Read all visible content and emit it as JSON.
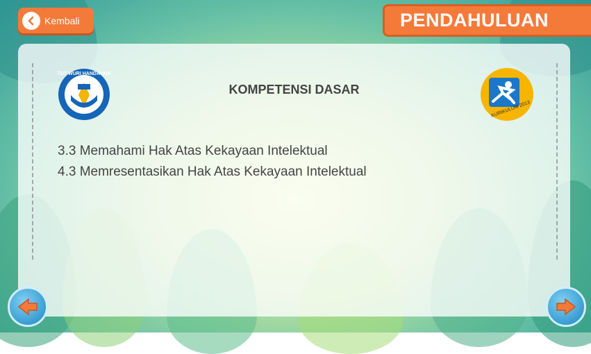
{
  "header": {
    "back_label": "Kembali",
    "title": "PENDAHULUAN"
  },
  "card": {
    "heading": "KOMPETENSI DASAR",
    "items": [
      "3.3 Memahami Hak Atas Kekayaan Intelektual",
      "4.3 Memresentasikan Hak Atas Kekayaan Intelektual"
    ],
    "logo_left_text": "TUT WURI HANDAYANI",
    "logo_right_text": "KURIKULUM 2013"
  },
  "nav": {
    "prev_icon": "arrow-left-icon",
    "next_icon": "arrow-right-icon"
  },
  "colors": {
    "accent": "#f47a3a",
    "nav_blue": "#1d86c4",
    "text": "#444444"
  }
}
